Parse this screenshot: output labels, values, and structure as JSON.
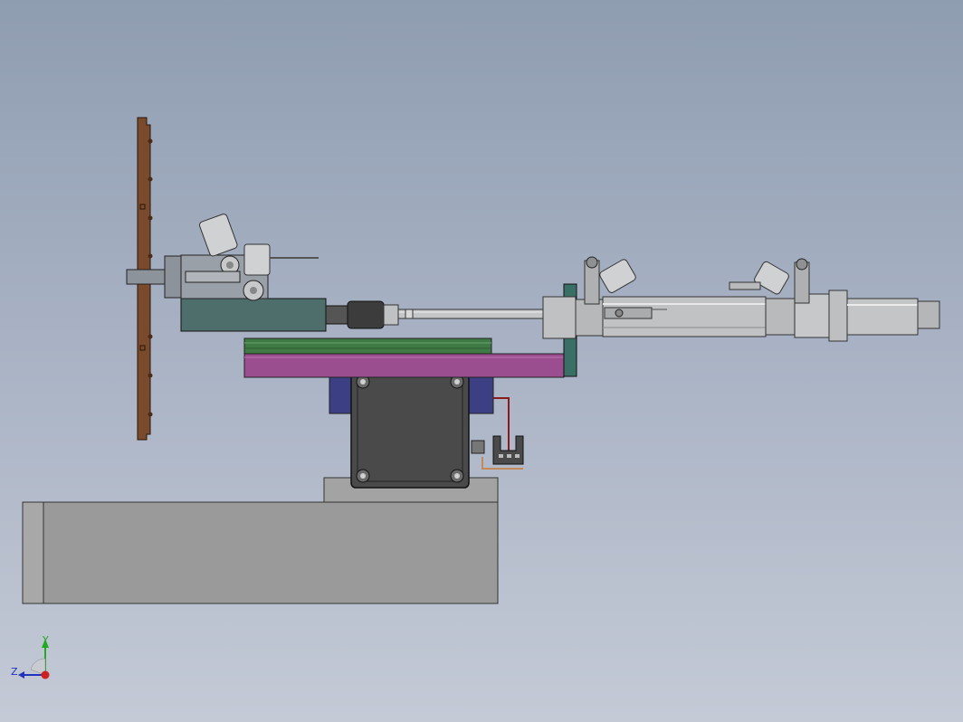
{
  "viewport": {
    "background_top": "#8f9db1",
    "background_bottom": "#c4cad6"
  },
  "model": {
    "parts": [
      "vertical-rail",
      "rotary-gripper-assembly",
      "pneumatic-cylinder",
      "piston-rod",
      "guide-plate",
      "slide-plate",
      "mounting-flange",
      "stepper-motor",
      "sensor-bracket",
      "motor-base",
      "base-block"
    ],
    "colors": {
      "rail": "#7a4a2c",
      "green_plate": "#3f7a45",
      "magenta_plate": "#9a4d8f",
      "motor": "#4a4a4a",
      "flange": "#3a6f66",
      "cylinder": "#b9bcc0",
      "base": "#999999",
      "navy_block": "#3d3f85"
    }
  },
  "triad": {
    "x_label": "",
    "y_label": "Y",
    "z_label": "Z",
    "y_color": "#22aa22",
    "z_color": "#2233bb",
    "origin_color": "#cc2222"
  }
}
